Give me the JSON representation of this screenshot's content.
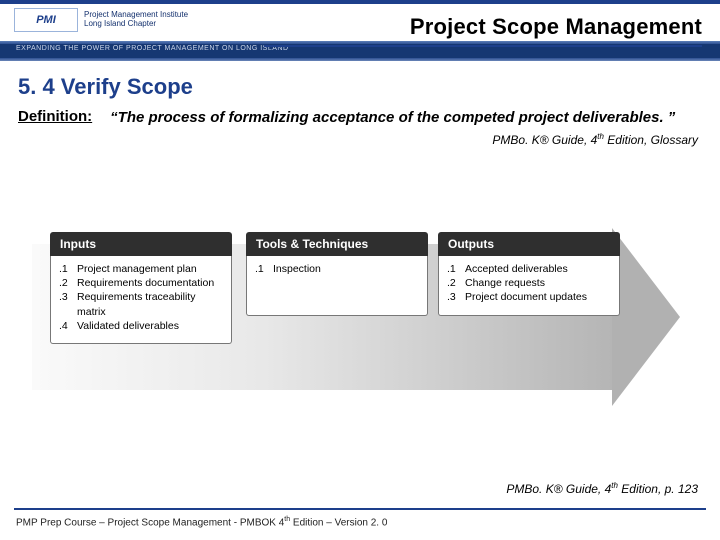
{
  "header": {
    "title": "Project Scope Management",
    "logo": {
      "mark_text": "PMI",
      "line1": "Project Management Institute",
      "line2": "Long Island Chapter"
    },
    "tagline": "EXPANDING THE POWER OF PROJECT MANAGEMENT ON LONG ISLAND"
  },
  "section": {
    "heading": "5. 4 Verify Scope",
    "definition_label": "Definition:",
    "definition_text": "“The process of formalizing acceptance of the competed project deliverables. ”",
    "citation_top_prefix": "PMBo. K® Guide, 4",
    "citation_top_sup": "th",
    "citation_top_suffix": " Edition, Glossary",
    "citation_bottom_prefix": "PMBo. K® Guide, 4",
    "citation_bottom_sup": "th",
    "citation_bottom_suffix": " Edition, p. 123"
  },
  "diagram": {
    "columns": [
      {
        "header": "Inputs",
        "items": [
          {
            "num": ".1",
            "text": "Project management plan"
          },
          {
            "num": ".2",
            "text": "Requirements documentation"
          },
          {
            "num": ".3",
            "text": "Requirements traceability matrix"
          },
          {
            "num": ".4",
            "text": "Validated deliverables"
          }
        ]
      },
      {
        "header": "Tools & Techniques",
        "items": [
          {
            "num": ".1",
            "text": "Inspection"
          }
        ]
      },
      {
        "header": "Outputs",
        "items": [
          {
            "num": ".1",
            "text": "Accepted deliverables"
          },
          {
            "num": ".2",
            "text": "Change requests"
          },
          {
            "num": ".3",
            "text": "Project document updates"
          }
        ]
      }
    ]
  },
  "footer": {
    "text_prefix": "PMP Prep Course – Project Scope Management - PMBOK 4",
    "text_sup": "th",
    "text_suffix": " Edition – Version 2. 0"
  }
}
